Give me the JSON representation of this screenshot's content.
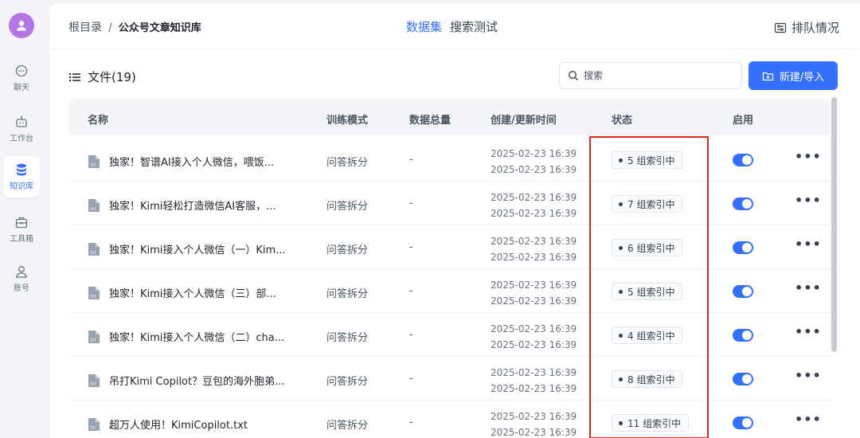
{
  "sidebar": {
    "items": [
      {
        "label": "聊天",
        "icon": "chat-icon"
      },
      {
        "label": "工作台",
        "icon": "robot-icon"
      },
      {
        "label": "知识库",
        "icon": "database-icon",
        "active": true
      },
      {
        "label": "工具箱",
        "icon": "toolbox-icon"
      },
      {
        "label": "账号",
        "icon": "user-icon"
      }
    ]
  },
  "header": {
    "breadcrumb_root": "根目录",
    "breadcrumb_sep": "/",
    "breadcrumb_current": "公众号文章知识库",
    "tabs": [
      {
        "label": "数据集",
        "active": true
      },
      {
        "label": "搜索测试",
        "active": false
      }
    ],
    "queue_label": "排队情况"
  },
  "toolbar": {
    "files_title": "文件(19)",
    "search_placeholder": "搜索",
    "new_button_label": "新建/导入"
  },
  "table": {
    "columns": [
      "名称",
      "训练模式",
      "数据总量",
      "创建/更新时间",
      "状态",
      "启用"
    ],
    "rows": [
      {
        "name": "独家！智谱AI接入个人微信，喂饭...",
        "mode": "问答拆分",
        "total": "-",
        "created": "2025-02-23 16:39",
        "updated": "2025-02-23 16:39",
        "status": "5 组索引中",
        "enabled": true
      },
      {
        "name": "独家！Kimi轻松打造微信AI客服，...",
        "mode": "问答拆分",
        "total": "-",
        "created": "2025-02-23 16:39",
        "updated": "2025-02-23 16:39",
        "status": "7 组索引中",
        "enabled": true
      },
      {
        "name": "独家！Kimi接入个人微信（一）Kim...",
        "mode": "问答拆分",
        "total": "-",
        "created": "2025-02-23 16:39",
        "updated": "2025-02-23 16:39",
        "status": "6 组索引中",
        "enabled": true
      },
      {
        "name": "独家！Kimi接入个人微信（三）部...",
        "mode": "问答拆分",
        "total": "-",
        "created": "2025-02-23 16:39",
        "updated": "2025-02-23 16:39",
        "status": "5 组索引中",
        "enabled": true
      },
      {
        "name": "独家！Kimi接入个人微信（二）cha...",
        "mode": "问答拆分",
        "total": "-",
        "created": "2025-02-23 16:39",
        "updated": "2025-02-23 16:39",
        "status": "4 组索引中",
        "enabled": true
      },
      {
        "name": "吊打Kimi Copilot？豆包的海外胞弟...",
        "mode": "问答拆分",
        "total": "-",
        "created": "2025-02-23 16:39",
        "updated": "2025-02-23 16:39",
        "status": "8 组索引中",
        "enabled": true
      },
      {
        "name": "超万人使用！KimiCopilot.txt",
        "mode": "问答拆分",
        "total": "-",
        "created": "2025-02-23 16:39",
        "updated": "2025-02-23 16:39",
        "status": "11 组索引中",
        "enabled": true
      }
    ],
    "file_icon_text": "TXT",
    "more_label": "•••"
  },
  "colors": {
    "accent": "#3370ff",
    "highlight_frame": "#e02424",
    "avatar": "#b675e6"
  }
}
